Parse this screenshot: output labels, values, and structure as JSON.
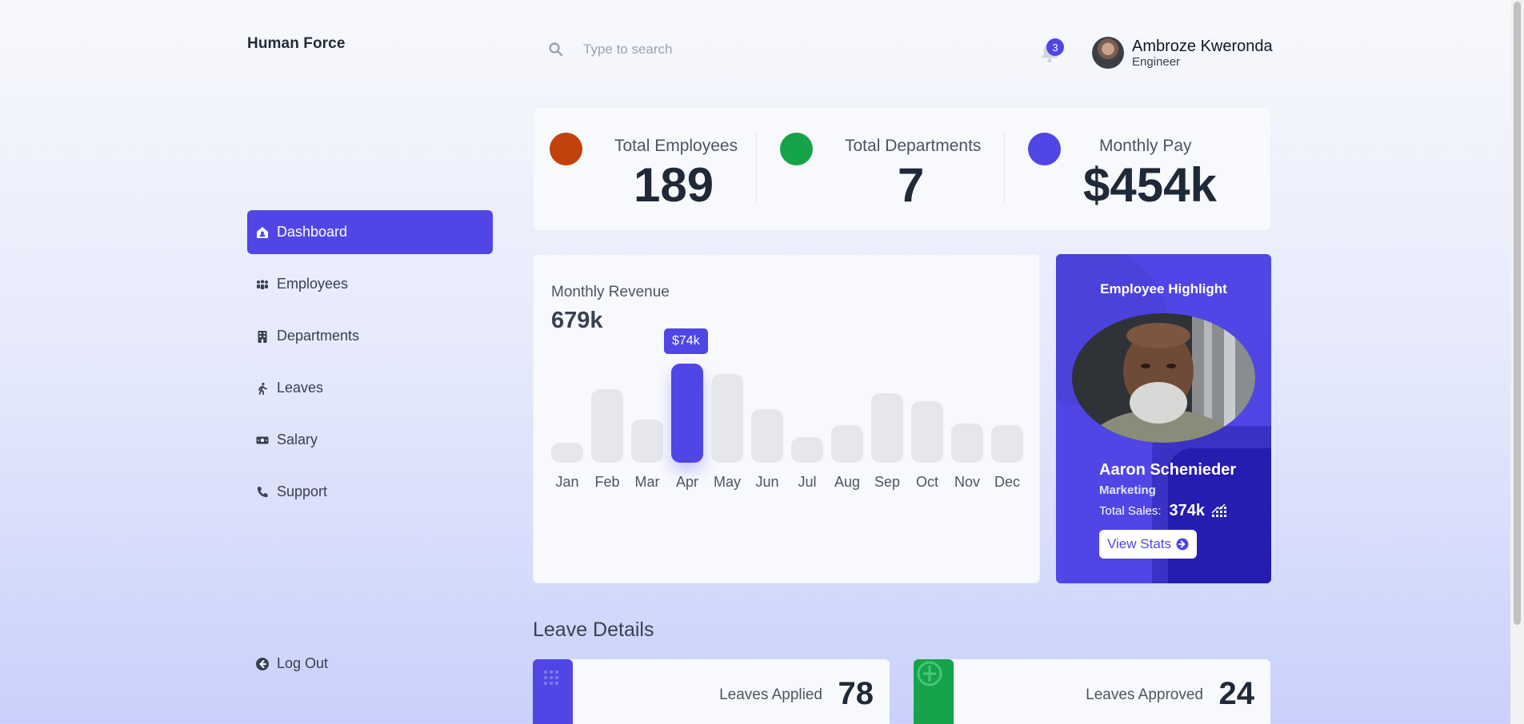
{
  "app": {
    "brand": "Human Force"
  },
  "sidebar": {
    "items": [
      {
        "label": "Dashboard",
        "icon": "house-user-icon",
        "active": true
      },
      {
        "label": "Employees",
        "icon": "people-group-icon"
      },
      {
        "label": "Departments",
        "icon": "building-icon"
      },
      {
        "label": "Leaves",
        "icon": "person-walking-icon"
      },
      {
        "label": "Salary",
        "icon": "money-bill-icon"
      },
      {
        "label": "Support",
        "icon": "phone-icon"
      }
    ],
    "logout_label": "Log Out"
  },
  "header": {
    "search_placeholder": "Type to search",
    "notification_count": "3",
    "user": {
      "name": "Ambroze Kweronda",
      "role": "Engineer"
    }
  },
  "stats": [
    {
      "label": "Total Employees",
      "value": "189",
      "color": "#c2410c"
    },
    {
      "label": "Total Departments",
      "value": "7",
      "color": "#16a34a"
    },
    {
      "label": "Monthly Pay",
      "value": "$454k",
      "color": "#4f46e5"
    }
  ],
  "revenue": {
    "title": "Monthly Revenue",
    "total": "679k",
    "tooltip": "$74k"
  },
  "chart_data": {
    "type": "bar",
    "categories": [
      "Jan",
      "Feb",
      "Mar",
      "Apr",
      "May",
      "Jun",
      "Jul",
      "Aug",
      "Sep",
      "Oct",
      "Nov",
      "Dec"
    ],
    "values": [
      15,
      55,
      32,
      74,
      66,
      40,
      19,
      28,
      52,
      46,
      29,
      28
    ],
    "highlight": "Apr",
    "colors": {
      "default": "#e6e7eb",
      "highlight": "#4f46e5"
    }
  },
  "highlight": {
    "title": "Employee Highlight",
    "name": "Aaron Schenieder",
    "department": "Marketing",
    "sales_label": "Total Sales:",
    "sales_value": "374k",
    "button_label": "View Stats"
  },
  "leave": {
    "title": "Leave Details",
    "cards": [
      {
        "label": "Leaves Applied",
        "value": "78",
        "color": "#4f46e5"
      },
      {
        "label": "Leaves Approved",
        "value": "24",
        "color": "#16a34a"
      }
    ]
  }
}
